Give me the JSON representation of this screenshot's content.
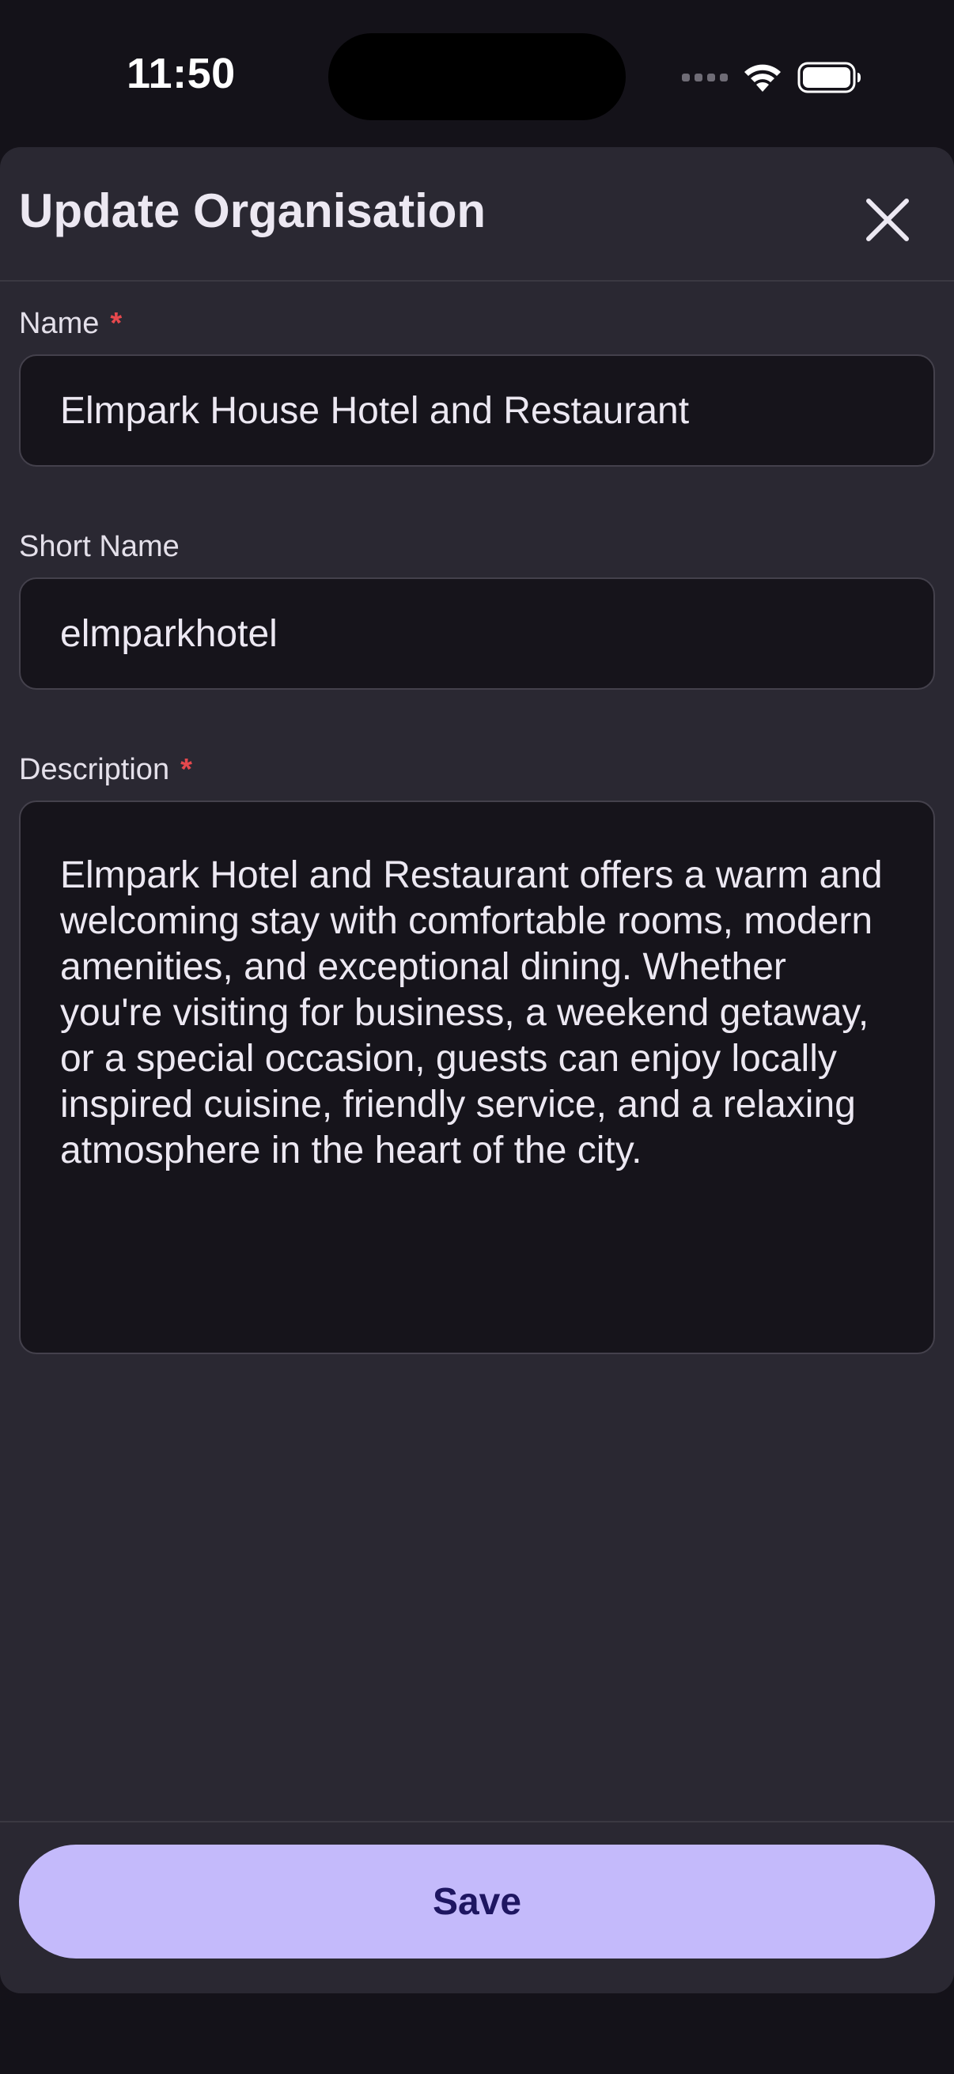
{
  "status_bar": {
    "time": "11:50",
    "icons": [
      "cellular-signal-icon",
      "wifi-icon",
      "battery-icon"
    ]
  },
  "sheet": {
    "title": "Update Organisation",
    "close_icon": "close-icon"
  },
  "form": {
    "name": {
      "label": "Name",
      "required_mark": "*",
      "value": "Elmpark House Hotel and Restaurant"
    },
    "short_name": {
      "label": "Short Name",
      "value": "elmparkhotel"
    },
    "description": {
      "label": "Description",
      "required_mark": "*",
      "value": "Elmpark Hotel and Restaurant offers a warm and welcoming stay with comfortable rooms, modern amenities, and exceptional dining. Whether you're visiting for business, a weekend getaway, or a special occasion, guests can enjoy locally inspired cuisine, friendly service, and a relaxing atmosphere in the heart of the city."
    }
  },
  "footer": {
    "save_label": "Save"
  },
  "colors": {
    "background": "#141219",
    "sheet": "#2a2832",
    "field": "#16141b",
    "accent": "#c4bafb",
    "accent_text": "#1e1661",
    "required": "#e5484d"
  }
}
